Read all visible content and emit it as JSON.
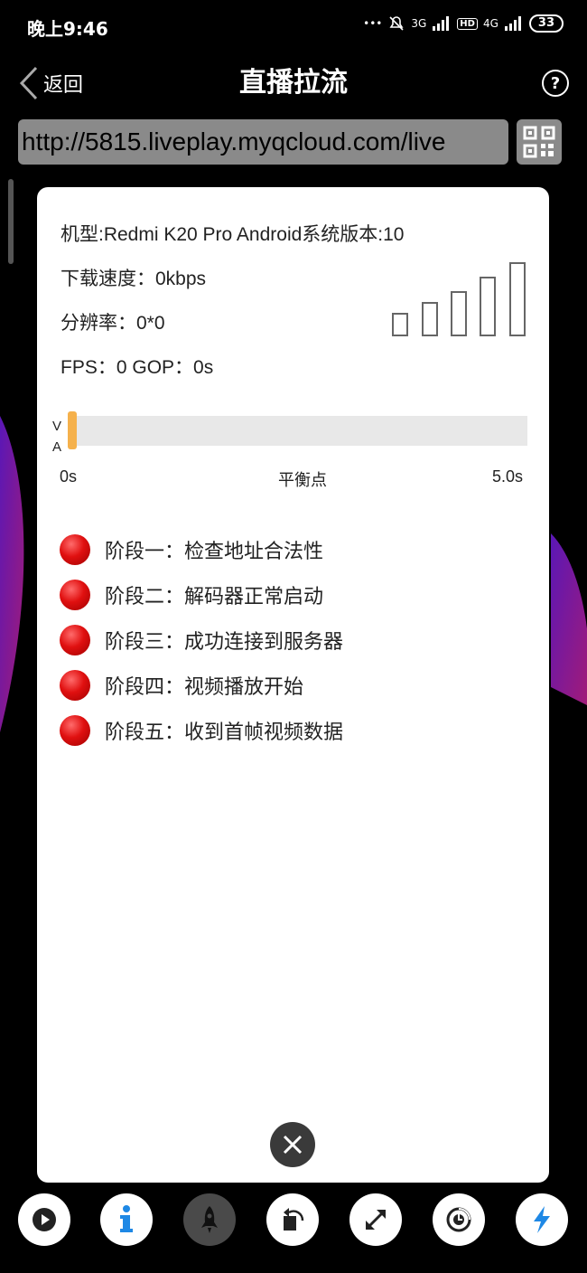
{
  "status_bar": {
    "time": "晚上9:46",
    "network_3g": "3G",
    "hd": "HD",
    "network_4g": "4G",
    "battery": "33"
  },
  "header": {
    "back_label": "返回",
    "title": "直播拉流",
    "help_symbol": "?"
  },
  "url_input": {
    "value": "http://5815.liveplay.myqcloud.com/live"
  },
  "info": {
    "device": "机型:Redmi K20 Pro Android系统版本:10",
    "download_speed": "下载速度：0kbps",
    "resolution": "分辨率：0*0",
    "fps_gop": "FPS：0  GOP：0s"
  },
  "buffer": {
    "v_label": "V",
    "a_label": "A",
    "start": "0s",
    "middle": "平衡点",
    "end": "5.0s",
    "level": 0
  },
  "stages": [
    {
      "label": "阶段一：检查地址合法性",
      "color": "#e01010"
    },
    {
      "label": "阶段二：解码器正常启动",
      "color": "#e01010"
    },
    {
      "label": "阶段三：成功连接到服务器",
      "color": "#e01010"
    },
    {
      "label": "阶段四：视频播放开始",
      "color": "#e01010"
    },
    {
      "label": "阶段五：收到首帧视频数据",
      "color": "#e01010"
    }
  ],
  "toolbar": [
    {
      "icon": "play-icon"
    },
    {
      "icon": "info-icon",
      "color": "#1e88e5"
    },
    {
      "icon": "rocket-icon",
      "state": "disabled"
    },
    {
      "icon": "rotate-icon"
    },
    {
      "icon": "fullscreen-icon"
    },
    {
      "icon": "speed-icon"
    },
    {
      "icon": "hardware-accel-icon",
      "color": "#1e88e5"
    }
  ]
}
